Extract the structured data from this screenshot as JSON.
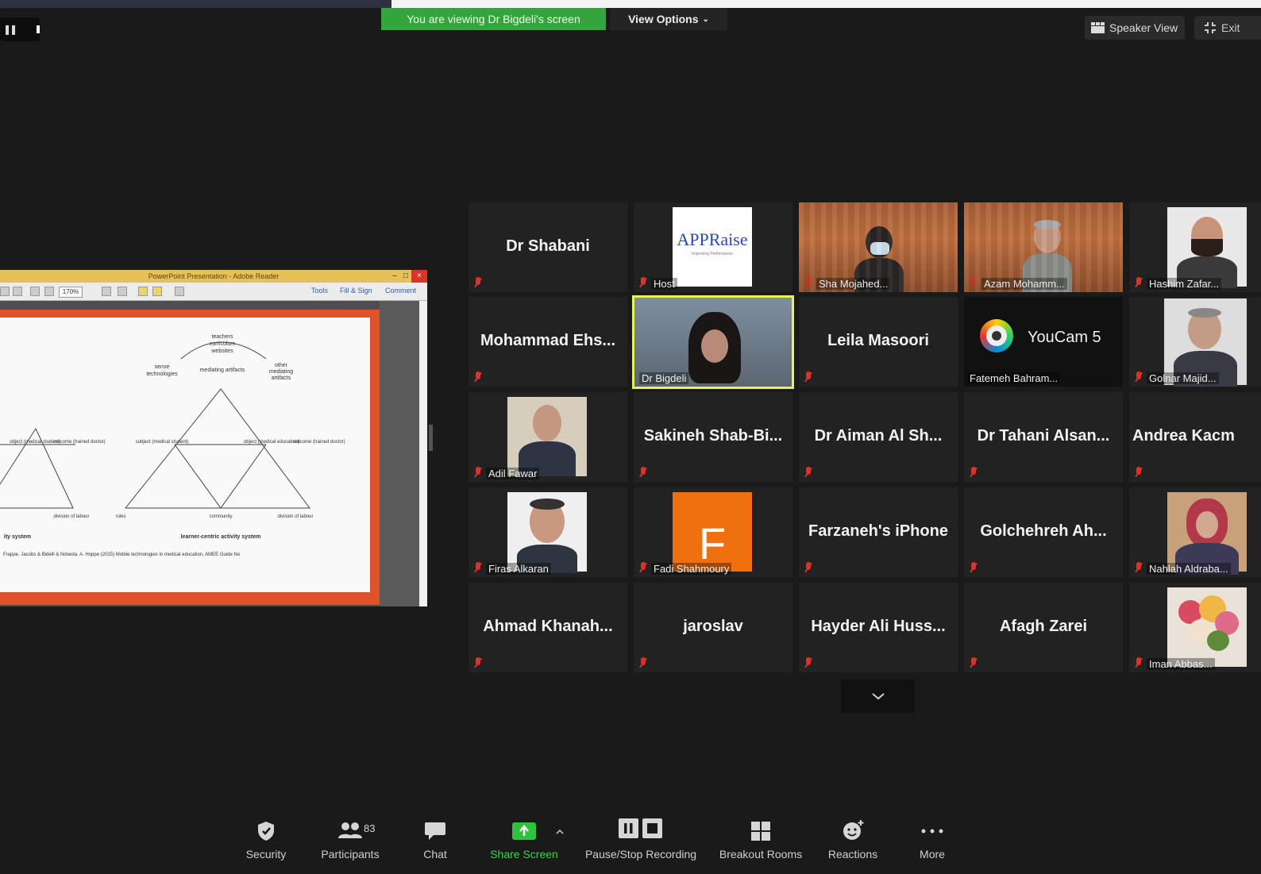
{
  "banner": {
    "viewing_text": "You are viewing Dr Bigdeli's screen",
    "view_options": "View Options",
    "view_options_icon": "chevron-down-icon"
  },
  "top_right": {
    "speaker_view": "Speaker View",
    "exit": "Exit"
  },
  "shared_screen": {
    "title": "PowerPoint Presentation - Adobe Reader",
    "toolbar_tabs": [
      "Tools",
      "Fill & Sign",
      "Comment"
    ],
    "zoom": "170%",
    "slide": {
      "top_labels": [
        "teachers",
        "curriculum",
        "websites"
      ],
      "mediating_label": "mediating artifacts",
      "left_labels": [
        "sense",
        "technologies"
      ],
      "right_labels": [
        "other",
        "mediating",
        "artifacts"
      ],
      "left_triangle": {
        "object": "object (medical student)",
        "outcome": "outcome (trained doctor)",
        "bottom": "division of labour"
      },
      "right_triangle": {
        "subject": "subject (medical student)",
        "object": "object (medical education)",
        "outcome": "outcome (trained doctor)",
        "rules": "rules",
        "community": "community",
        "division": "division of labour"
      },
      "left_caption": "ity system",
      "right_caption": "learner-centric activity system",
      "footer": "Frappe, Jacobs & Bidelli & Ndoeda. A. Hoppe (2015) Mobile technologies in medical education. AMEE Guide No"
    }
  },
  "participants": [
    {
      "name": "Dr Shabani",
      "type": "name"
    },
    {
      "name": "Host",
      "type": "logo",
      "logo_text": "APPRaise",
      "logo_sub": "Improving Performance"
    },
    {
      "name": "Sha Mojahed...",
      "type": "photo"
    },
    {
      "name": "Azam Mohamm...",
      "type": "photo"
    },
    {
      "name": "Hashim Zafar...",
      "type": "photo"
    },
    {
      "name": "Mohammad  Ehs...",
      "type": "name"
    },
    {
      "name": "Dr Bigdeli",
      "type": "photo",
      "active": true
    },
    {
      "name": "Leila Masoori",
      "type": "name"
    },
    {
      "name": "Fatemeh Bahram...",
      "type": "logo",
      "logo_text": "YouCam 5"
    },
    {
      "name": "Golnar Majid...",
      "type": "photo"
    },
    {
      "name": "Adil Fawar",
      "type": "photo"
    },
    {
      "name": "Sakineh  Shab-Bi...",
      "type": "name"
    },
    {
      "name": "Dr  Aiman  Al  Sh...",
      "type": "name"
    },
    {
      "name": "Dr  Tahani  Alsan...",
      "type": "name"
    },
    {
      "name": "Andrea  Kacm",
      "type": "name"
    },
    {
      "name": "Firas Alkaran",
      "type": "photo"
    },
    {
      "name": "Fadi Shahmoury",
      "type": "letter",
      "letter": "F"
    },
    {
      "name": "Farzaneh's iPhone",
      "type": "name"
    },
    {
      "name": "Golchehreh  Ah...",
      "type": "name"
    },
    {
      "name": "Nahlah Aldraba...",
      "type": "photo"
    },
    {
      "name": "Ahmad  Khanah...",
      "type": "name"
    },
    {
      "name": "jaroslav",
      "type": "name"
    },
    {
      "name": "Hayder  Ali  Huss...",
      "type": "name"
    },
    {
      "name": "Afagh Zarei",
      "type": "name"
    },
    {
      "name": "Iman Abbas...",
      "type": "photo"
    }
  ],
  "toolbar": {
    "security": "Security",
    "participants": "Participants",
    "participants_count": "83",
    "chat": "Chat",
    "share_screen": "Share Screen",
    "recording": "Pause/Stop Recording",
    "breakout": "Breakout Rooms",
    "reactions": "Reactions",
    "more": "More"
  },
  "colors": {
    "share_green": "#3ad64a",
    "active_speaker": "#e8f15a",
    "muted_red": "#d9332a",
    "banner_green": "#34a53c"
  }
}
